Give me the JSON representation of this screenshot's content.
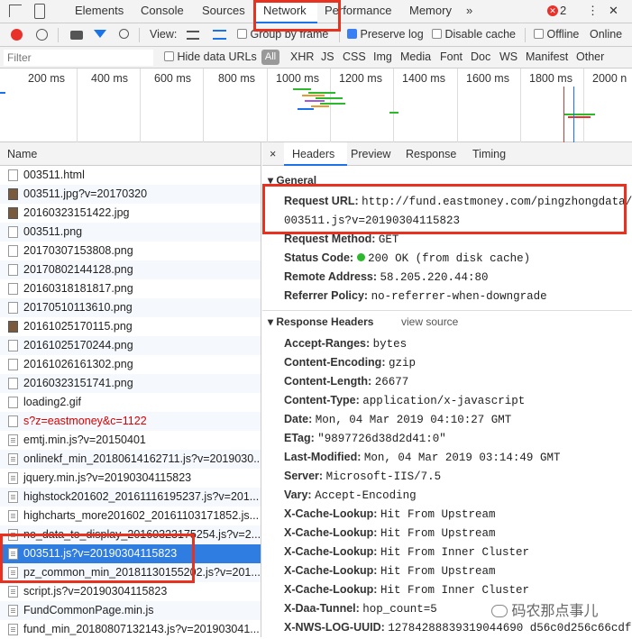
{
  "tabs": {
    "elements": "Elements",
    "console": "Console",
    "sources": "Sources",
    "network": "Network",
    "performance": "Performance",
    "memory": "Memory",
    "more": "»",
    "errors": "2",
    "menu": "⋮",
    "close": "✕"
  },
  "toolbar": {
    "view": "View:",
    "group_by_frame": "Group by frame",
    "preserve_log": "Preserve log",
    "disable_cache": "Disable cache",
    "offline": "Offline",
    "online": "Online"
  },
  "filter": {
    "placeholder": "Filter",
    "hide_data_urls": "Hide data URLs",
    "types": [
      "All",
      "XHR",
      "JS",
      "CSS",
      "Img",
      "Media",
      "Font",
      "Doc",
      "WS",
      "Manifest",
      "Other"
    ]
  },
  "overview": {
    "ticks": [
      "200 ms",
      "400 ms",
      "600 ms",
      "800 ms",
      "1000 ms",
      "1200 ms",
      "1400 ms",
      "1600 ms",
      "1800 ms",
      "2000 n"
    ]
  },
  "name_header": "Name",
  "requests": [
    {
      "name": "003511.html",
      "icon": "doc"
    },
    {
      "name": "003511.jpg?v=20170320",
      "icon": "img"
    },
    {
      "name": "20160323151422.jpg",
      "icon": "img"
    },
    {
      "name": "003511.png",
      "icon": "doc"
    },
    {
      "name": "20170307153808.png",
      "icon": "doc"
    },
    {
      "name": "20170802144128.png",
      "icon": "doc"
    },
    {
      "name": "20160318181817.png",
      "icon": "doc"
    },
    {
      "name": "20170510113610.png",
      "icon": "doc"
    },
    {
      "name": "20161025170115.png",
      "icon": "img"
    },
    {
      "name": "20161025170244.png",
      "icon": "doc"
    },
    {
      "name": "20161026161302.png",
      "icon": "doc"
    },
    {
      "name": "20160323151741.png",
      "icon": "doc"
    },
    {
      "name": "loading2.gif",
      "icon": "doc"
    },
    {
      "name": "s?z=eastmoney&c=1122",
      "icon": "doc",
      "error": true
    },
    {
      "name": "emtj.min.js?v=20150401",
      "icon": "js"
    },
    {
      "name": "onlinekf_min_20180614162711.js?v=2019030...",
      "icon": "js"
    },
    {
      "name": "jquery.min.js?v=20190304115823",
      "icon": "js"
    },
    {
      "name": "highstock201602_20161116195237.js?v=201...",
      "icon": "js"
    },
    {
      "name": "highcharts_more201602_20161103171852.js...",
      "icon": "js"
    },
    {
      "name": "no_data_to_display_20160323175254.js?v=2...",
      "icon": "js"
    },
    {
      "name": "003511.js?v=20190304115823",
      "icon": "js",
      "selected": true
    },
    {
      "name": "pz_common_min_20181130155202.js?v=201...",
      "icon": "js"
    },
    {
      "name": "script.js?v=20190304115823",
      "icon": "js"
    },
    {
      "name": "FundCommonPage.min.js",
      "icon": "js"
    },
    {
      "name": "fund_min_20180807132143.js?v=201903041...",
      "icon": "js"
    }
  ],
  "detail_tabs": {
    "close": "×",
    "headers": "Headers",
    "preview": "Preview",
    "response": "Response",
    "timing": "Timing"
  },
  "general": {
    "title": "General",
    "request_url_key": "Request URL:",
    "request_url_line1": "http://fund.eastmoney.com/pingzhongdata/",
    "request_url_line2": "003511.js?v=20190304115823",
    "request_method_key": "Request Method:",
    "request_method": "GET",
    "status_code_key": "Status Code:",
    "status_code": "200 OK (from disk cache)",
    "remote_address_key": "Remote Address:",
    "remote_address": "58.205.220.44:80",
    "referrer_policy_key": "Referrer Policy:",
    "referrer_policy": "no-referrer-when-downgrade"
  },
  "response_headers": {
    "title": "Response Headers",
    "view_source": "view source",
    "items": [
      {
        "k": "Accept-Ranges:",
        "v": "bytes"
      },
      {
        "k": "Content-Encoding:",
        "v": "gzip"
      },
      {
        "k": "Content-Length:",
        "v": "26677"
      },
      {
        "k": "Content-Type:",
        "v": "application/x-javascript"
      },
      {
        "k": "Date:",
        "v": "Mon, 04 Mar 2019 04:10:27 GMT"
      },
      {
        "k": "ETag:",
        "v": "\"9897726d38d2d41:0\""
      },
      {
        "k": "Last-Modified:",
        "v": "Mon, 04 Mar 2019 03:14:49 GMT"
      },
      {
        "k": "Server:",
        "v": "Microsoft-IIS/7.5"
      },
      {
        "k": "Vary:",
        "v": "Accept-Encoding"
      },
      {
        "k": "X-Cache-Lookup:",
        "v": "Hit From Upstream"
      },
      {
        "k": "X-Cache-Lookup:",
        "v": "Hit From Upstream"
      },
      {
        "k": "X-Cache-Lookup:",
        "v": "Hit From Inner Cluster"
      },
      {
        "k": "X-Cache-Lookup:",
        "v": "Hit From Upstream"
      },
      {
        "k": "X-Cache-Lookup:",
        "v": "Hit From Inner Cluster"
      },
      {
        "k": "X-Daa-Tunnel:",
        "v": "hop_count=5"
      },
      {
        "k": "X-NWS-LOG-UUID:",
        "v": "12784288839319044690 d56c0d256c66cdf"
      }
    ]
  },
  "watermark": "码农那点事儿",
  "colors": {
    "selected_row": "#2f7de1",
    "highlight_box": "#e8311e",
    "record": "#e8312b",
    "status_ok": "#2eb82e"
  }
}
